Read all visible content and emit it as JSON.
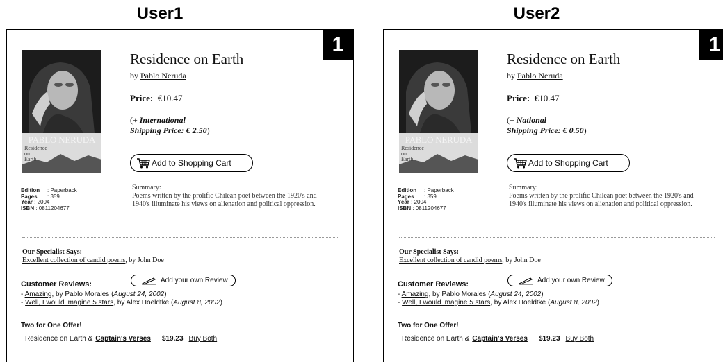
{
  "panels": [
    {
      "user_label": "User1",
      "badge": "1",
      "cover": {
        "author": "PABLO NERUDA",
        "title_lines": [
          "Residence",
          "on",
          "Earth"
        ]
      },
      "book": {
        "title": "Residence on Earth",
        "by": "by",
        "author": "Pablo Neruda"
      },
      "price": {
        "label": "Price:",
        "value": "€10.47"
      },
      "shipping": {
        "prefix": "(+",
        "line1": "International",
        "line2": "Shipping Price: € 2.50",
        "suffix": ")"
      },
      "cart_button": "Add to Shopping Cart",
      "details": [
        {
          "label": "Edition",
          "value": ": Paperback"
        },
        {
          "label": "Pages",
          "value": ": 359"
        },
        {
          "label": "Year",
          "value": ": 2004"
        },
        {
          "label": "ISBN",
          "value": ": 0811204677"
        }
      ],
      "summary": {
        "label": "Summary:",
        "text": "Poems written by the prolific Chilean poet between the 1920's and 1940's illuminate his views on alienation and political oppression."
      },
      "specialist": {
        "heading": "Our Specialist Says:",
        "link": "Excellent collection of candid poems",
        "by": ", by John Doe"
      },
      "reviews": {
        "heading": "Customer Reviews:",
        "button": "Add your own Review",
        "items": [
          {
            "dash": "- ",
            "link": "Amazing",
            "by": ", by Pablo Morales (",
            "date": "August 24, 2002",
            "end": ")"
          },
          {
            "dash": "- ",
            "link": "Well, I would imagine 5 stars",
            "by": ", by Alex Hoeldtke (",
            "date": "August 8, 2002",
            "end": ")"
          }
        ]
      },
      "offer": {
        "heading": "Two for One Offer!",
        "first": "Residence on Earth &",
        "second": "Captain's Verses",
        "price": "$19.23",
        "buy": "Buy Both"
      }
    },
    {
      "user_label": "User2",
      "badge": "1",
      "cover": {
        "author": "PABLO NERUDA",
        "title_lines": [
          "Residence",
          "on",
          "Earth"
        ]
      },
      "book": {
        "title": "Residence on Earth",
        "by": "by",
        "author": "Pablo Neruda"
      },
      "price": {
        "label": "Price:",
        "value": "€10.47"
      },
      "shipping": {
        "prefix": "(+",
        "line1": "National",
        "line2": "Shipping Price: € 0.50",
        "suffix": ")"
      },
      "cart_button": "Add to Shopping Cart",
      "details": [
        {
          "label": "Edition",
          "value": ": Paperback"
        },
        {
          "label": "Pages",
          "value": ": 359"
        },
        {
          "label": "Year",
          "value": ": 2004"
        },
        {
          "label": "ISBN",
          "value": ": 0811204677"
        }
      ],
      "summary": {
        "label": "Summary:",
        "text": "Poems written by the prolific Chilean poet between the 1920's and 1940's illuminate his views on alienation and political oppression."
      },
      "specialist": {
        "heading": "Our Specialist Says:",
        "link": "Excellent collection of candid poems",
        "by": ", by John Doe"
      },
      "reviews": {
        "heading": "Customer Reviews:",
        "button": "Add your own Review",
        "items": [
          {
            "dash": "- ",
            "link": "Amazing",
            "by": ", by Pablo Morales (",
            "date": "August 24, 2002",
            "end": ")"
          },
          {
            "dash": "- ",
            "link": "Well, I would imagine 5 stars",
            "by": ", by Alex Hoeldtke (",
            "date": "August 8, 2002",
            "end": ")"
          }
        ]
      },
      "offer": {
        "heading": "Two for One Offer!",
        "first": "Residence on Earth &",
        "second": "Captain's Verses",
        "price": "$19.23",
        "buy": "Buy Both"
      }
    }
  ]
}
